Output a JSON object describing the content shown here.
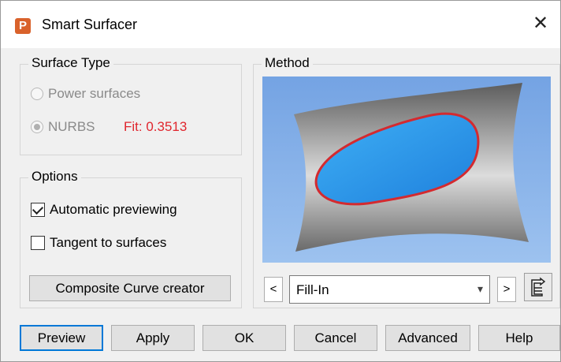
{
  "window": {
    "title": "Smart Surfacer",
    "icon": "app-p-icon",
    "close_icon": "close-icon"
  },
  "surface_type": {
    "label": "Surface Type",
    "options": [
      {
        "label": "Power surfaces",
        "selected": false,
        "enabled": false
      },
      {
        "label": "NURBS",
        "selected": true,
        "enabled": false
      }
    ],
    "fit_text": "Fit: 0.3513"
  },
  "options": {
    "label": "Options",
    "automatic_previewing": {
      "label": "Automatic previewing",
      "checked": true
    },
    "tangent_to_surfaces": {
      "label": "Tangent to surfaces",
      "checked": false
    },
    "composite_button": "Composite Curve creator"
  },
  "method": {
    "label": "Method",
    "prev": "<",
    "next": ">",
    "selected": "Fill-In",
    "dropdown_icon": "chevron-down-icon",
    "tool_icon": "surface-tool-icon"
  },
  "footer": {
    "preview": "Preview",
    "apply": "Apply",
    "ok": "OK",
    "cancel": "Cancel",
    "advanced": "Advanced",
    "help": "Help"
  },
  "colors": {
    "accent": "#0078d7",
    "fit": "#e0262e",
    "fill_blue": "#2f9fe8",
    "outline_red": "#d42a2f"
  }
}
